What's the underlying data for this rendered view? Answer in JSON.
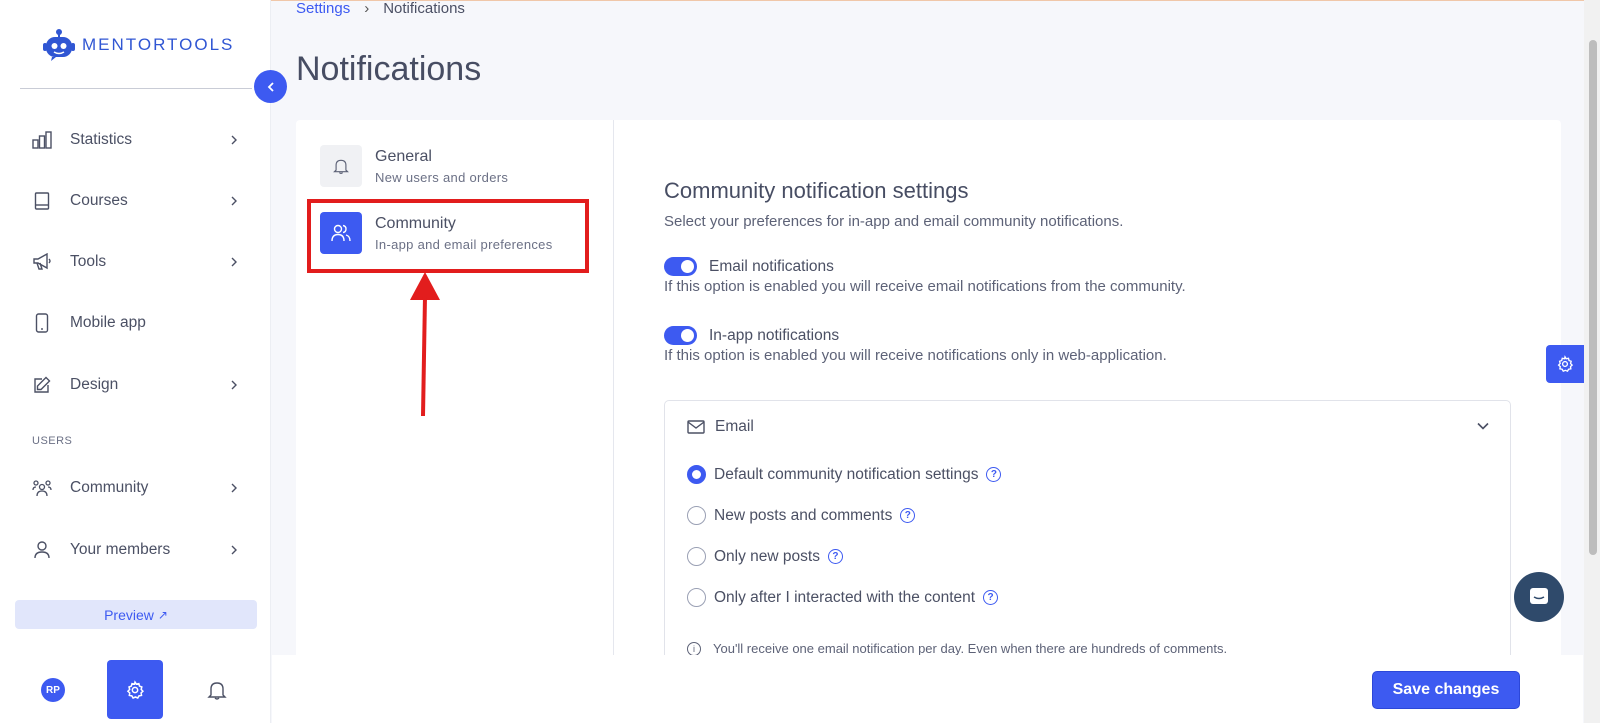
{
  "brand": {
    "name": "MENTORTOOLS",
    "accent": "#3d5af1"
  },
  "sidebar": {
    "items": [
      {
        "label": "Statistics",
        "icon": "bar-chart-icon",
        "chevron": true
      },
      {
        "label": "Courses",
        "icon": "book-icon",
        "chevron": true
      },
      {
        "label": "Tools",
        "icon": "megaphone-icon",
        "chevron": true
      },
      {
        "label": "Mobile app",
        "icon": "phone-icon",
        "chevron": false
      },
      {
        "label": "Design",
        "icon": "edit-icon",
        "chevron": true
      }
    ],
    "section_users": "USERS",
    "user_items": [
      {
        "label": "Community",
        "icon": "community-icon",
        "chevron": true
      },
      {
        "label": "Your members",
        "icon": "person-icon",
        "chevron": true
      }
    ],
    "preview_label": "Preview",
    "avatar_initials": "RP"
  },
  "breadcrumb": {
    "parent": "Settings",
    "current": "Notifications"
  },
  "page_title": "Notifications",
  "settings_menu": [
    {
      "title": "General",
      "subtitle": "New users and orders",
      "icon": "bell-icon",
      "active": false
    },
    {
      "title": "Community",
      "subtitle": "In-app and email preferences",
      "icon": "users-icon",
      "active": true
    }
  ],
  "community_settings": {
    "title": "Community notification settings",
    "subtitle": "Select your preferences for in-app and email community notifications.",
    "toggles": [
      {
        "label": "Email notifications",
        "description": "If this option is enabled you will receive email notifications from the community.",
        "on": true
      },
      {
        "label": "In-app notifications",
        "description": "If this option is enabled you will receive notifications only in web-application.",
        "on": true
      }
    ],
    "email_panel": {
      "header": "Email",
      "options": [
        {
          "label": "Default community notification settings",
          "checked": true
        },
        {
          "label": "New posts and comments",
          "checked": false
        },
        {
          "label": "Only new posts",
          "checked": false
        },
        {
          "label": "Only after I interacted with the content",
          "checked": false
        }
      ],
      "info": "You'll receive one email notification per day. Even when there are hundreds of comments."
    }
  },
  "save_label": "Save changes"
}
